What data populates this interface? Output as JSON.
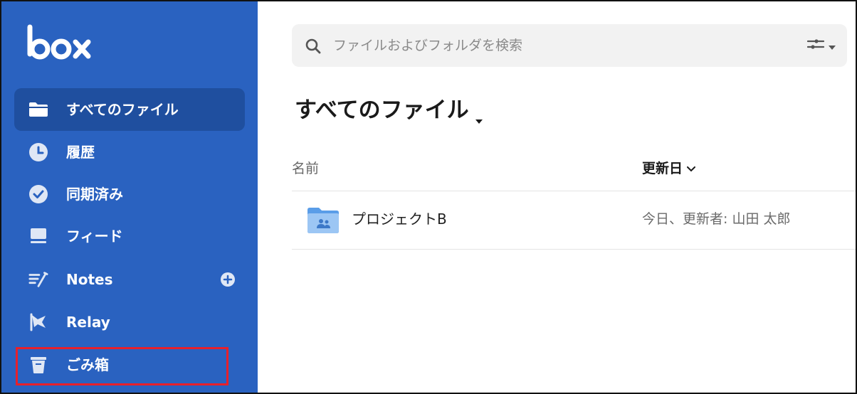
{
  "app": {
    "logo_text": "box"
  },
  "sidebar": {
    "items": [
      {
        "label": "すべてのファイル",
        "icon": "folder-icon",
        "active": true
      },
      {
        "label": "履歴",
        "icon": "clock-icon"
      },
      {
        "label": "同期済み",
        "icon": "check-circle-icon"
      },
      {
        "label": "フィード",
        "icon": "feed-icon"
      },
      {
        "label": "Notes",
        "icon": "notes-icon",
        "action_icon": "plus-circle-icon"
      },
      {
        "label": "Relay",
        "icon": "relay-flag-icon"
      },
      {
        "label": "ごみ箱",
        "icon": "trash-icon",
        "highlighted": true
      }
    ],
    "colors": {
      "background": "#2a62c0",
      "active": "#1f4f9f",
      "highlight_border": "#e8202a"
    }
  },
  "search": {
    "placeholder": "ファイルおよびフォルダを検索",
    "value": ""
  },
  "main": {
    "title": "すべてのファイル",
    "columns": {
      "name": "名前",
      "modified": "更新日"
    },
    "rows": [
      {
        "name": "プロジェクトB",
        "modified": "今日、更新者: 山田 太郎",
        "icon": "shared-folder-icon"
      }
    ]
  }
}
